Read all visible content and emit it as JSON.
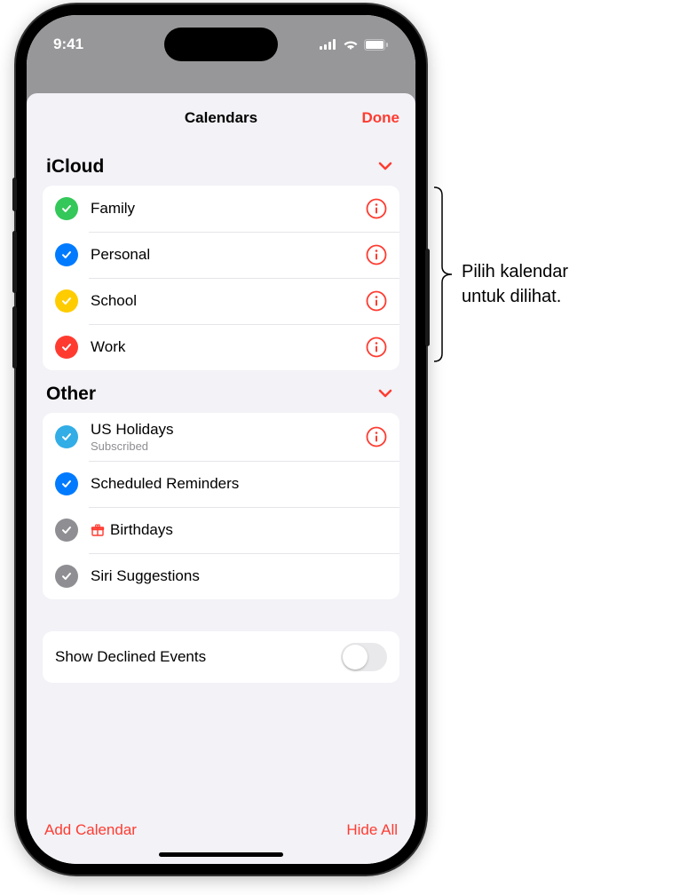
{
  "status": {
    "time": "9:41"
  },
  "sheet": {
    "title": "Calendars",
    "done": "Done"
  },
  "sections": [
    {
      "title": "iCloud",
      "items": [
        {
          "label": "Family",
          "color": "#34c759",
          "info": true
        },
        {
          "label": "Personal",
          "color": "#007aff",
          "info": true
        },
        {
          "label": "School",
          "color": "#ffcc00",
          "info": true
        },
        {
          "label": "Work",
          "color": "#ff3b30",
          "info": true
        }
      ]
    },
    {
      "title": "Other",
      "items": [
        {
          "label": "US Holidays",
          "sublabel": "Subscribed",
          "color": "#32ade6",
          "info": true
        },
        {
          "label": "Scheduled Reminders",
          "color": "#007aff",
          "info": false
        },
        {
          "label": "Birthdays",
          "color": "#8e8e93",
          "info": false,
          "gift": true
        },
        {
          "label": "Siri Suggestions",
          "color": "#8e8e93",
          "info": false
        }
      ]
    }
  ],
  "toggle": {
    "label": "Show Declined Events",
    "value": false
  },
  "footer": {
    "add": "Add Calendar",
    "hide": "Hide All"
  },
  "annotation": {
    "line1": "Pilih kalendar",
    "line2": "untuk dilihat."
  },
  "accent": "#ff3b30"
}
